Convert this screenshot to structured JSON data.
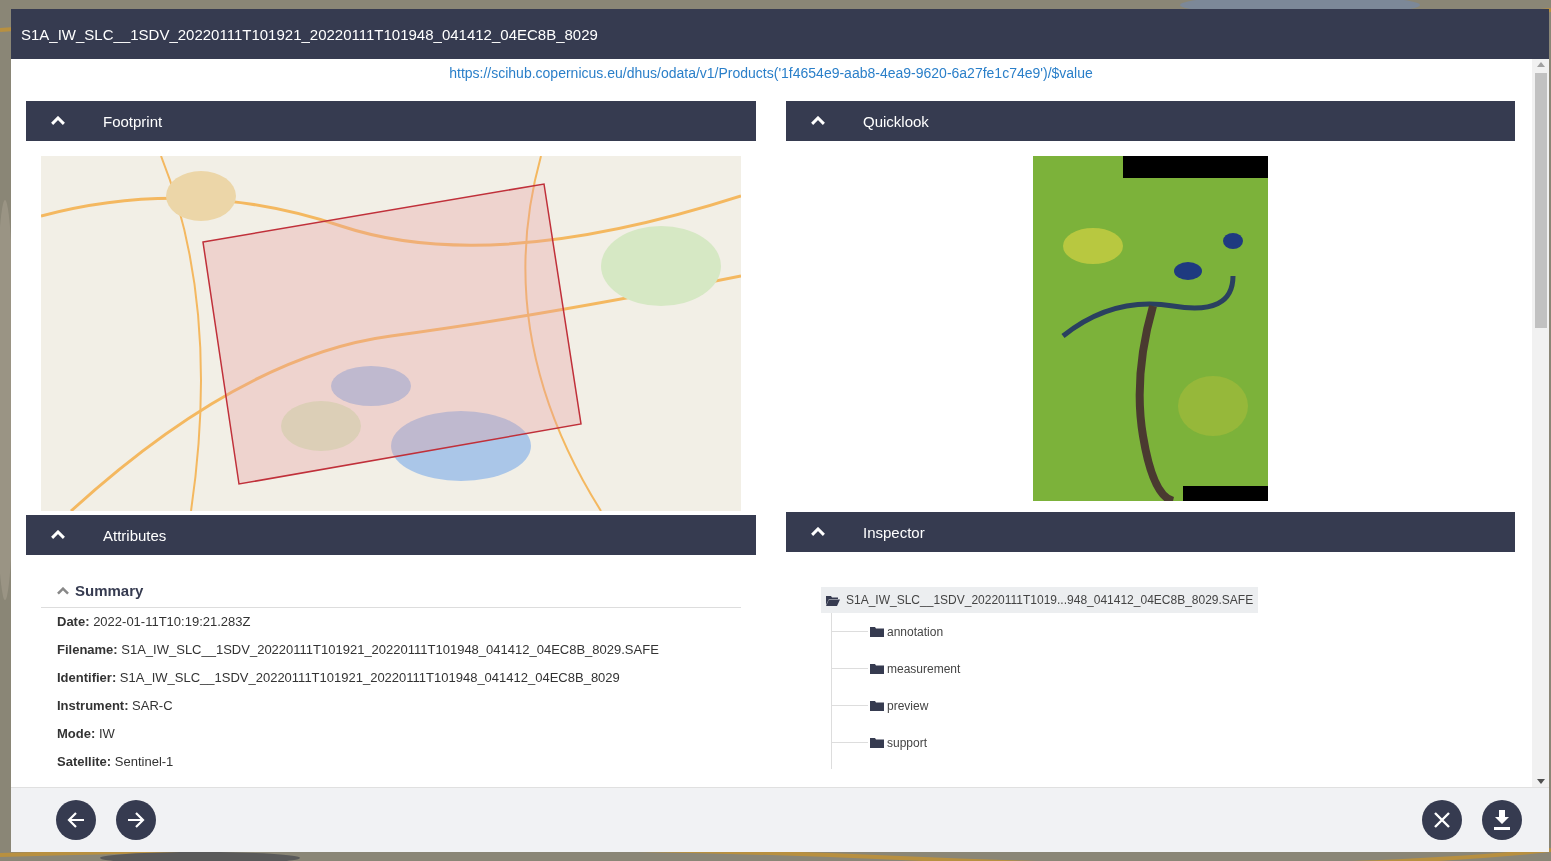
{
  "window": {
    "title": "S1A_IW_SLC__1SDV_20220111T101921_20220111T101948_041412_04EC8B_8029"
  },
  "link": "https://scihub.copernicus.eu/dhus/odata/v1/Products('1f4654e9-aab8-4ea9-9620-6a27fe1c74e9')/$value",
  "left_panels": [
    {
      "kind": "map",
      "title": "Footprint",
      "expanded": true
    },
    {
      "kind": "attributes",
      "title": "Attributes",
      "expanded": true,
      "section": {
        "title": "Summary",
        "expanded": true,
        "fields": [
          "**Date:** 2022-01-11T10:19:21.283Z",
          "**Filename:** S1A_IW_SLC__1SDV_20220111T101921_20220111T101948_041412_04EC8B_8029.SAFE",
          "**Identifier:** S1A_IW_SLC__1SDV_20220111T101921_20220111T101948_041412_04EC8B_8029",
          "**Instrument:** SAR-C",
          "**Mode:** IW",
          "**Satellite:** Sentinel-1"
        ]
      }
    }
  ],
  "right_panels": [
    {
      "title": "Quicklook",
      "expanded": true
    },
    {
      "kind": "tree",
      "title": "Inspector",
      "expanded": true,
      "tree": [
        {
          "name": "S1A_IW_SLC__1SDV_20220111T1019...948_041412_04EC8B_8029.SAFE",
          "selected": true,
          "expanded": true,
          "children": [
            {
              "name": "annotation",
              "selected": false,
              "expanded": false
            },
            {
              "name": "measurement",
              "selected": false,
              "expanded": false
            },
            {
              "name": "preview",
              "selected": false,
              "expanded": false
            },
            {
              "name": "support",
              "selected": false,
              "expanded": false
            }
          ]
        }
      ]
    }
  ]
}
